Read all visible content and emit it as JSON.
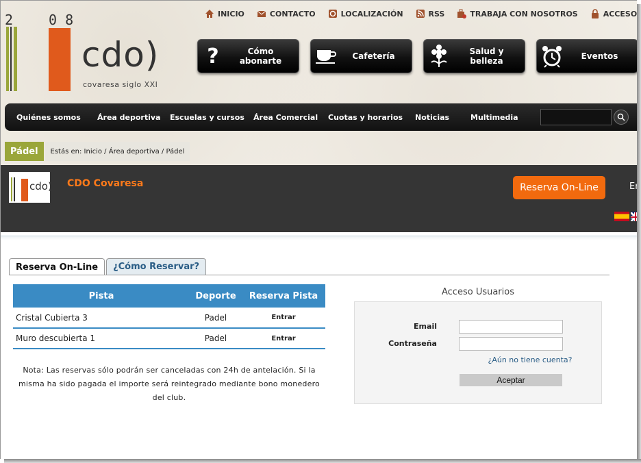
{
  "logo": {
    "num_left": "2",
    "num_right": "0 8",
    "text": "cdo)",
    "subtitle": "covaresa siglo XXI"
  },
  "topnav": [
    {
      "icon": "home-icon",
      "label": "INICIO"
    },
    {
      "icon": "mail-icon",
      "label": "CONTACTO"
    },
    {
      "icon": "location-icon",
      "label": "LOCALIZACIÓN"
    },
    {
      "icon": "rss-icon",
      "label": "RSS"
    },
    {
      "icon": "work-icon",
      "label": "TRABAJA CON NOSOTROS"
    },
    {
      "icon": "lock-icon",
      "label": "ACCESO PRIVADO"
    }
  ],
  "bigbuttons": [
    {
      "icon": "question-icon",
      "label": "Cómo abonarte"
    },
    {
      "icon": "coffee-cup-icon",
      "label": "Cafetería"
    },
    {
      "icon": "flower-icon",
      "label": "Salud y belleza"
    },
    {
      "icon": "alarm-clock-icon",
      "label": "Eventos"
    }
  ],
  "mainnav": [
    "Quiénes somos",
    "Área deportiva",
    "Escuelas y cursos",
    "Área Comercial",
    "Cuotas y horarios",
    "Noticias",
    "Multimedia"
  ],
  "breadcrumb": {
    "section": "Pádel",
    "path": "Estás en: Inicio / Área deportiva / Pádel"
  },
  "club": {
    "name": "CDO Covaresa",
    "reserve_button": "Reserva On-Line",
    "lang_link": "En"
  },
  "tabs": [
    {
      "label": "Reserva On-Line",
      "active": true
    },
    {
      "label": "¿Cómo Reservar?",
      "active": false
    }
  ],
  "courts_table": {
    "headers": [
      "Pista",
      "Deporte",
      "Reserva Pista"
    ],
    "rows": [
      {
        "pista": "Cristal Cubierta 3",
        "deporte": "Padel",
        "action": "Entrar"
      },
      {
        "pista": "Muro descubierta 1",
        "deporte": "Padel",
        "action": "Entrar"
      }
    ]
  },
  "note": "Nota: Las reservas sólo podrán ser canceladas con 24h de antelación. Si la misma ha sido pagada el importe será reintegrado mediante bono monedero del club.",
  "login": {
    "title": "Acceso Usuarios",
    "email_label": "Email",
    "password_label": "Contraseña",
    "signup_link": "¿Aún no tiene cuenta?",
    "submit": "Aceptar"
  },
  "colors": {
    "accent_orange": "#f26a0e",
    "table_blue": "#3a8bc4",
    "section_green": "#9aa63a"
  }
}
